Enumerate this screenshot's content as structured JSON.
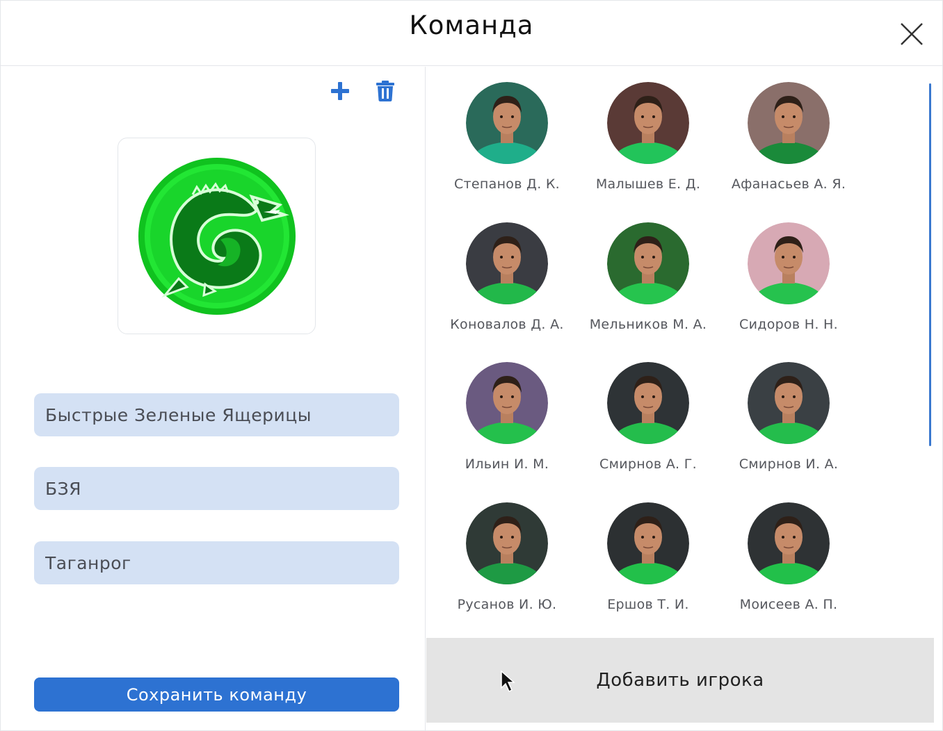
{
  "dialog": {
    "title": "Команда"
  },
  "team": {
    "name": "Быстрые Зеленые Ящерицы",
    "short_name": "БЗЯ",
    "city": "Таганрог",
    "save_label": "Сохранить команду"
  },
  "players": [
    {
      "name": "Степанов Д. К.",
      "bg": "#2a6a5a",
      "shirt": "#1fae8a"
    },
    {
      "name": "Малышев Е. Д.",
      "bg": "#5a3a36",
      "shirt": "#22c45a"
    },
    {
      "name": "Афанасьев А. Я.",
      "bg": "#8a6f6a",
      "shirt": "#1a8a3a"
    },
    {
      "name": "Коновалов Д. А.",
      "bg": "#3a3c42",
      "shirt": "#22b84a"
    },
    {
      "name": "Мельников М. А.",
      "bg": "#2a6a2f",
      "shirt": "#26c44e"
    },
    {
      "name": "Сидоров Н. Н.",
      "bg": "#d7a9b4",
      "shirt": "#26c24e"
    },
    {
      "name": "Ильин И. М.",
      "bg": "#6a5a80",
      "shirt": "#24c04c"
    },
    {
      "name": "Смирнов А. Г.",
      "bg": "#2e3336",
      "shirt": "#24bd4c"
    },
    {
      "name": "Смирнов И. А.",
      "bg": "#3a4044",
      "shirt": "#24bd4c"
    },
    {
      "name": "Русанов И. Ю.",
      "bg": "#2f3a36",
      "shirt": "#1e9a44"
    },
    {
      "name": "Ершов Т. И.",
      "bg": "#2c3032",
      "shirt": "#22c04a"
    },
    {
      "name": "Моисеев А. П.",
      "bg": "#2e3234",
      "shirt": "#22c04a"
    }
  ],
  "add_player_label": "Добавить игрока",
  "colors": {
    "accent": "#2d72d2",
    "input_bg": "#d4e1f4",
    "logo_green": "#19e12c"
  },
  "icons": {
    "close": "close-icon",
    "add": "plus-icon",
    "delete": "trash-icon",
    "logo": "lizard-logo"
  }
}
